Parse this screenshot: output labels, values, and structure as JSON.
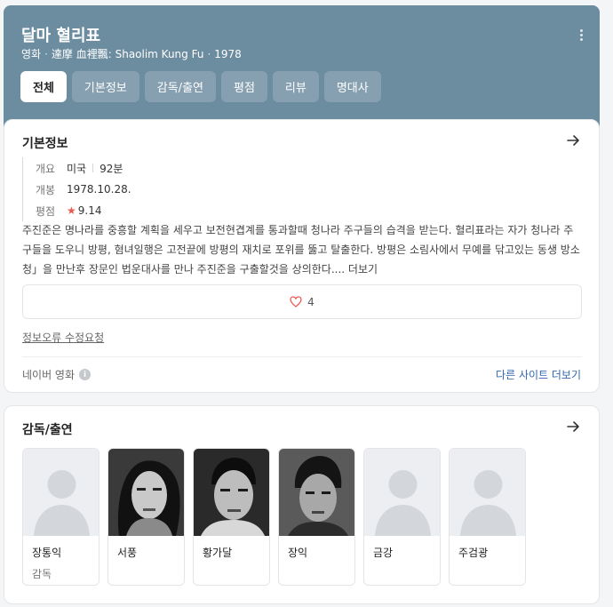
{
  "header": {
    "title": "달마 혈리표",
    "subtitle": {
      "category": "영화",
      "original_title": "達摩 血裡飄: Shaolim Kung Fu",
      "year": "1978"
    },
    "more_icon": "more-vertical-icon"
  },
  "tabs": [
    {
      "label": "전체",
      "active": true
    },
    {
      "label": "기본정보",
      "active": false
    },
    {
      "label": "감독/출연",
      "active": false
    },
    {
      "label": "평점",
      "active": false
    },
    {
      "label": "리뷰",
      "active": false
    },
    {
      "label": "명대사",
      "active": false
    }
  ],
  "basic_info": {
    "title": "기본정보",
    "rows": {
      "overview_label": "개요",
      "country": "미국",
      "runtime": "92분",
      "release_label": "개봉",
      "release_date": "1978.10.28.",
      "rating_label": "평점",
      "rating": "9.14"
    },
    "synopsis": "주진준은 명나라를 중흥할 계획을 세우고 보전현겹계를 통과할때 청나라 주구들의 습격을 받는다. 혈리표라는 자가 청나라 주구들을 도우니 방평, 혐녀일행은 고전끝에 방평의 재치로 포위를 뚫고 탈출한다. 방평은 소림사에서 무예를 닦고있는 동생 방소청」을 만난후 장문인 법운대사를 만나 주진준을 구출할것을 상의한다....",
    "synopsis_more": "더보기",
    "likes": "4",
    "report_link": "정보오류 수정요청",
    "source": "네이버 영화",
    "more_sites": "다른 사이트 더보기"
  },
  "cast_section": {
    "title": "감독/출연",
    "people": [
      {
        "name": "장통익",
        "role": "감독",
        "photo": "placeholder"
      },
      {
        "name": "서풍",
        "role": "",
        "photo": "bw-portrait-woman"
      },
      {
        "name": "황가달",
        "role": "",
        "photo": "bw-portrait-man"
      },
      {
        "name": "장익",
        "role": "",
        "photo": "bw-portrait-man"
      },
      {
        "name": "금강",
        "role": "",
        "photo": "placeholder"
      },
      {
        "name": "주검광",
        "role": "",
        "photo": "placeholder"
      }
    ]
  },
  "colors": {
    "header_bg": "#6c8ca0",
    "link": "#3267b2",
    "star": "#e95b50"
  }
}
